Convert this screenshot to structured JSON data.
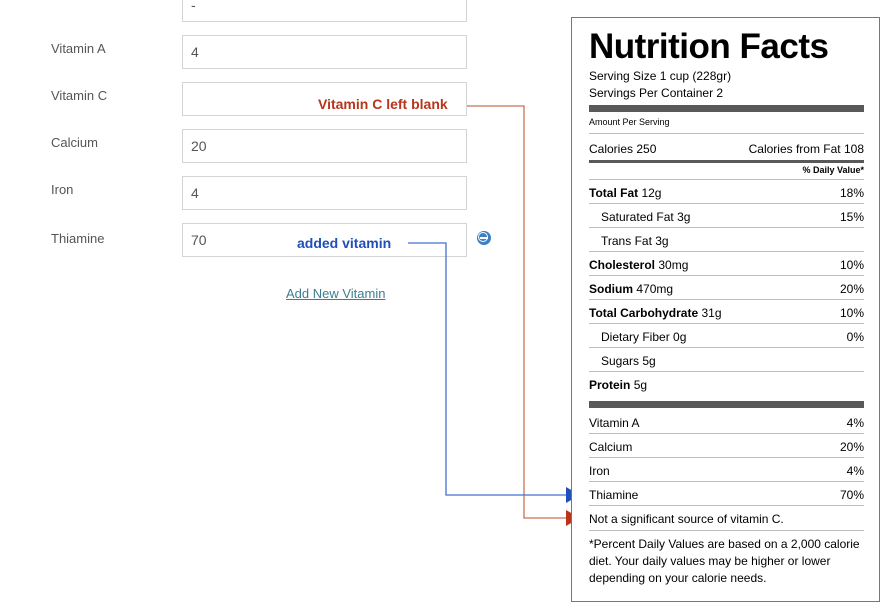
{
  "form": {
    "top_input_value": "-",
    "rows": [
      {
        "label": "Vitamin A",
        "value": "4"
      },
      {
        "label": "Vitamin C",
        "value": ""
      },
      {
        "label": "Calcium",
        "value": "20"
      },
      {
        "label": "Iron",
        "value": "4"
      },
      {
        "label": "Thiamine",
        "value": "70"
      }
    ],
    "add_link": "Add New Vitamin"
  },
  "annotations": {
    "vitamin_c_note": "Vitamin C left blank",
    "added_note": "added vitamin",
    "red_color": "#b8341b",
    "blue_color": "#1f4fb8"
  },
  "nutrition": {
    "title": "Nutrition Facts",
    "serving_size": "Serving Size 1 cup (228gr)",
    "servings_per_container": "Servings Per Container 2",
    "amount_per_serving": "Amount Per Serving",
    "calories": "Calories 250",
    "calories_from_fat": "Calories from Fat 108",
    "daily_value_header": "% Daily Value*",
    "nutrients": [
      {
        "name": "Total Fat",
        "amount": "12g",
        "dv": "18%"
      },
      {
        "name": "Saturated Fat",
        "amount": "3g",
        "dv": "15%"
      },
      {
        "name": "Trans Fat",
        "amount": "3g",
        "dv": ""
      },
      {
        "name": "Cholesterol",
        "amount": "30mg",
        "dv": "10%"
      },
      {
        "name": "Sodium",
        "amount": "470mg",
        "dv": "20%"
      },
      {
        "name": "Total Carbohydrate",
        "amount": "31g",
        "dv": "10%"
      },
      {
        "name": "Dietary Fiber",
        "amount": "0g",
        "dv": "0%"
      },
      {
        "name": "Sugars",
        "amount": "5g",
        "dv": ""
      },
      {
        "name": "Protein",
        "amount": "5g",
        "dv": ""
      }
    ],
    "vitamins": [
      {
        "name": "Vitamin A",
        "dv": "4%"
      },
      {
        "name": "Calcium",
        "dv": "20%"
      },
      {
        "name": "Iron",
        "dv": "4%"
      },
      {
        "name": "Thiamine",
        "dv": "70%"
      }
    ],
    "not_significant": "Not a significant source of vitamin C.",
    "footnote": "*Percent Daily Values are based on a 2,000 calorie diet. Your daily values may be higher or lower depending on your calorie needs."
  }
}
